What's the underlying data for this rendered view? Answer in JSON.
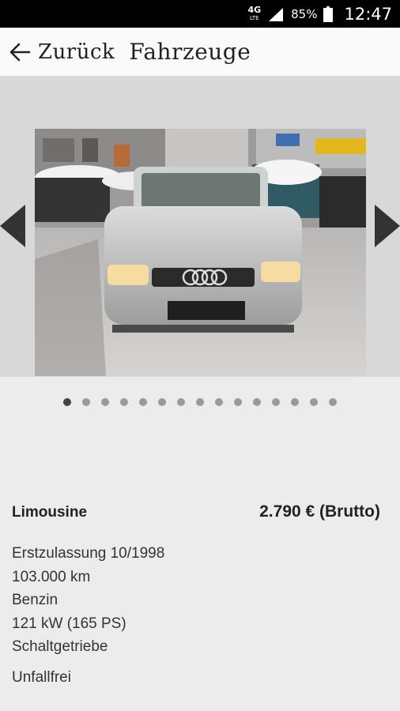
{
  "status_bar": {
    "network": "4G",
    "network_sub": "LTE",
    "battery_percent": "85%",
    "time": "12:47"
  },
  "app_bar": {
    "back_label": "Zurück",
    "title": "Fahrzeuge"
  },
  "gallery": {
    "image_count": 15,
    "active_index": 0,
    "icons": {
      "prev": "chevron-left-icon",
      "next": "chevron-right-icon"
    },
    "dots": [
      {
        "active": true
      },
      {
        "active": false
      },
      {
        "active": false
      },
      {
        "active": false
      },
      {
        "active": false
      },
      {
        "active": false
      },
      {
        "active": false
      },
      {
        "active": false
      },
      {
        "active": false
      },
      {
        "active": false
      },
      {
        "active": false
      },
      {
        "active": false
      },
      {
        "active": false
      },
      {
        "active": false
      },
      {
        "active": false
      }
    ]
  },
  "vehicle": {
    "body_type": "Limousine",
    "price": "2.790 € (Brutto)",
    "specs": [
      "Erstzulassung 10/1998",
      "103.000 km",
      "Benzin",
      "121 kW (165 PS)",
      "Schaltgetriebe"
    ],
    "extra": "Unfallfrei"
  },
  "colors": {
    "status_bar": "#000000",
    "app_bar": "#fafafa",
    "page_background": "#ececec",
    "gallery_background": "#d8d8d8",
    "dot_active": "#444444",
    "dot_inactive": "#9a9a9a"
  }
}
